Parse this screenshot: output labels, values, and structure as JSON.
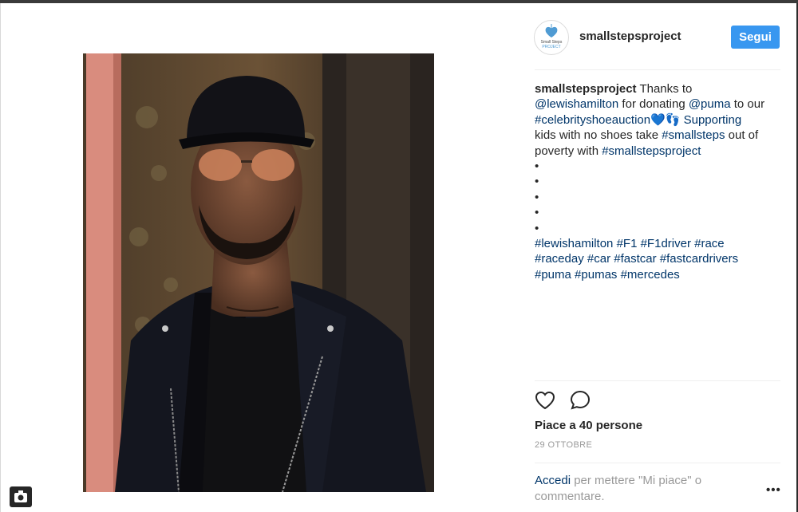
{
  "window": {
    "top_bar_text": ""
  },
  "post": {
    "username": "smallstepsproject",
    "avatar_logo": "Small Steps PROJECT",
    "follow_label": "Segui",
    "caption_lines": [
      {
        "parts": [
          {
            "t": "smallstepsproject",
            "k": "user"
          },
          {
            "t": " Thanks to",
            "k": "text"
          }
        ]
      },
      {
        "parts": [
          {
            "t": "@lewishamilton",
            "k": "tag"
          },
          {
            "t": " for donating ",
            "k": "text"
          },
          {
            "t": "@puma",
            "k": "tag"
          },
          {
            "t": " to our",
            "k": "text"
          }
        ]
      },
      {
        "parts": [
          {
            "t": "#celebrityshoeauction",
            "k": "tag"
          },
          {
            "t": "💙👣",
            "k": "text"
          },
          {
            "t": " Supporting",
            "k": "tag"
          }
        ]
      },
      {
        "parts": [
          {
            "t": "kids with no shoes take ",
            "k": "text"
          },
          {
            "t": "#smallsteps",
            "k": "tag"
          },
          {
            "t": " out of",
            "k": "text"
          }
        ]
      },
      {
        "parts": [
          {
            "t": "poverty with ",
            "k": "text"
          },
          {
            "t": "#smallstepsproject",
            "k": "tag"
          }
        ]
      },
      {
        "parts": [
          {
            "t": "•",
            "k": "text"
          }
        ]
      },
      {
        "parts": [
          {
            "t": "•",
            "k": "text"
          }
        ]
      },
      {
        "parts": [
          {
            "t": "•",
            "k": "text"
          }
        ]
      },
      {
        "parts": [
          {
            "t": "•",
            "k": "text"
          }
        ]
      },
      {
        "parts": [
          {
            "t": "•",
            "k": "text"
          }
        ]
      },
      {
        "parts": [
          {
            "t": "#lewishamilton",
            "k": "tag"
          },
          {
            "t": " ",
            "k": "text"
          },
          {
            "t": "#F1",
            "k": "tag"
          },
          {
            "t": " ",
            "k": "text"
          },
          {
            "t": "#F1driver",
            "k": "tag"
          },
          {
            "t": " ",
            "k": "text"
          },
          {
            "t": "#race",
            "k": "tag"
          }
        ]
      },
      {
        "parts": [
          {
            "t": "#raceday",
            "k": "tag"
          },
          {
            "t": " ",
            "k": "text"
          },
          {
            "t": "#car",
            "k": "tag"
          },
          {
            "t": " ",
            "k": "text"
          },
          {
            "t": "#fastcar",
            "k": "tag"
          },
          {
            "t": " ",
            "k": "text"
          },
          {
            "t": "#fastcardrivers",
            "k": "tag"
          }
        ]
      },
      {
        "parts": [
          {
            "t": "#puma",
            "k": "tag"
          },
          {
            "t": " ",
            "k": "text"
          },
          {
            "t": "#pumas",
            "k": "tag"
          },
          {
            "t": " ",
            "k": "text"
          },
          {
            "t": "#mercedes",
            "k": "tag"
          }
        ]
      }
    ],
    "likes_text": "Piace a 40 persone",
    "date_text": "29 OTTOBRE",
    "login_link": "Accedi",
    "login_rest": " per mettere \"Mi piace\" o commentare.",
    "more_label": "•••",
    "icons": {
      "like": "heart-icon",
      "comment": "comment-icon",
      "more": "more-options-icon",
      "camera": "camera-icon"
    },
    "colors": {
      "follow_button": "#3897f0",
      "link": "#003569",
      "muted": "#999999",
      "text": "#262626"
    }
  }
}
